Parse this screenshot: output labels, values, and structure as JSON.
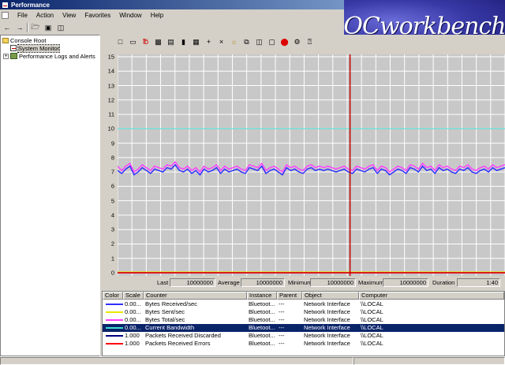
{
  "window": {
    "title": "Performance"
  },
  "menu": [
    "File",
    "Action",
    "View",
    "Favorites",
    "Window",
    "Help"
  ],
  "logo_text": "OCworkbench",
  "tree": {
    "root": "Console Root",
    "items": [
      "System Monitor",
      "Performance Logs and Alerts"
    ]
  },
  "toolbar_icons": [
    "new-counter-set-icon",
    "clear-display-icon",
    "view-current-activity-icon",
    "view-log-data-icon",
    "view-graph-icon",
    "view-histogram-icon",
    "view-report-icon",
    "add-counter-icon",
    "delete-counter-icon",
    "highlight-icon",
    "copy-properties-icon",
    "paste-counter-list-icon",
    "properties-icon",
    "freeze-display-icon",
    "update-data-icon",
    "help-icon"
  ],
  "chart_data": {
    "type": "line",
    "ylim": [
      0,
      15
    ],
    "yticks": [
      0,
      1,
      2,
      3,
      4,
      5,
      6,
      7,
      8,
      9,
      10,
      11,
      12,
      13,
      14,
      15
    ],
    "grid": true,
    "series": [
      {
        "name": "Bytes Received/sec",
        "color": "#3030ff",
        "values": [
          7.1,
          6.9,
          7.2,
          7.4,
          6.8,
          7.0,
          7.3,
          7.1,
          6.9,
          7.2,
          7.1,
          7.0,
          7.3,
          7.2,
          7.5,
          7.1,
          7.0,
          7.2,
          6.9,
          7.1,
          6.8,
          7.2,
          7.0,
          7.1,
          7.3,
          6.9,
          7.2,
          7.0,
          7.1,
          7.2,
          7.0,
          6.9,
          7.3,
          7.2,
          7.1,
          7.4,
          6.9,
          7.1,
          7.2,
          7.0,
          6.8,
          7.3,
          7.1,
          7.2,
          7.0,
          6.9,
          7.2,
          7.3,
          7.1,
          7.2,
          7.1,
          7.2,
          7.1,
          7.0,
          7.1,
          7.2,
          7.0,
          6.9,
          7.2,
          7.1,
          7.0,
          7.2,
          7.3,
          6.9,
          7.2,
          7.1,
          6.8,
          7.0,
          7.2,
          7.1,
          6.9,
          7.3,
          7.2,
          7.0,
          7.4,
          7.1,
          7.2,
          6.9,
          7.3,
          7.1,
          7.2,
          7.0,
          6.9,
          7.2,
          7.1,
          7.3,
          7.0,
          6.9,
          7.1,
          7.2,
          7.0,
          7.3,
          7.1,
          7.2,
          7.3
        ]
      },
      {
        "name": "Bytes Sent/sec",
        "color": "#e8e800",
        "values": [
          0.05,
          0.05,
          0.05,
          0.05,
          0.05,
          0.05,
          0.05,
          0.05,
          0.05,
          0.05
        ]
      },
      {
        "name": "Bytes Total/sec",
        "color": "#ff40ff",
        "values": [
          7.4,
          7.1,
          7.4,
          7.6,
          7.0,
          7.2,
          7.5,
          7.3,
          7.1,
          7.4,
          7.3,
          7.2,
          7.5,
          7.4,
          7.7,
          7.3,
          7.2,
          7.4,
          7.1,
          7.3,
          7.0,
          7.4,
          7.2,
          7.3,
          7.5,
          7.1,
          7.4,
          7.2,
          7.3,
          7.4,
          7.2,
          7.1,
          7.5,
          7.4,
          7.3,
          7.6,
          7.1,
          7.3,
          7.4,
          7.2,
          7.0,
          7.5,
          7.3,
          7.4,
          7.2,
          7.1,
          7.4,
          7.5,
          7.3,
          7.4,
          7.3,
          7.4,
          7.3,
          7.2,
          7.3,
          7.4,
          7.2,
          7.1,
          7.4,
          7.3,
          7.2,
          7.4,
          7.5,
          7.1,
          7.4,
          7.3,
          7.0,
          7.2,
          7.4,
          7.3,
          7.1,
          7.5,
          7.4,
          7.2,
          7.6,
          7.3,
          7.4,
          7.1,
          7.5,
          7.3,
          7.4,
          7.2,
          7.1,
          7.4,
          7.3,
          7.5,
          7.2,
          7.1,
          7.3,
          7.4,
          7.2,
          7.5,
          7.3,
          7.4,
          7.5
        ]
      },
      {
        "name": "Current Bandwidth",
        "color": "#40e0d0",
        "values": [
          10,
          10
        ]
      },
      {
        "name": "Packets Received Discarded",
        "color": "#000080",
        "values": [
          0,
          0
        ]
      },
      {
        "name": "Packets Received Errors",
        "color": "#ff0000",
        "values": [
          0,
          0
        ]
      }
    ],
    "vertical_marker_fraction": 0.6
  },
  "stats": {
    "last_label": "Last",
    "last_value": "10000000",
    "average_label": "Average",
    "average_value": "10000000",
    "minimum_label": "Minimum",
    "minimum_value": "10000000",
    "maximum_label": "Maximum",
    "maximum_value": "10000000",
    "duration_label": "Duration",
    "duration_value": "1:40"
  },
  "legend": {
    "headers": [
      "Color",
      "Scale",
      "Counter",
      "Instance",
      "Parent",
      "Object",
      "Computer"
    ],
    "rows": [
      {
        "color": "#3030ff",
        "scale": "0.00...",
        "counter": "Bytes Received/sec",
        "instance": "Bluetoot...",
        "parent": "---",
        "object": "Network Interface",
        "computer": "\\\\LOCAL"
      },
      {
        "color": "#e8e800",
        "scale": "0.00...",
        "counter": "Bytes Sent/sec",
        "instance": "Bluetoot...",
        "parent": "---",
        "object": "Network Interface",
        "computer": "\\\\LOCAL"
      },
      {
        "color": "#ff40ff",
        "scale": "0.00...",
        "counter": "Bytes Total/sec",
        "instance": "Bluetoot...",
        "parent": "---",
        "object": "Network Interface",
        "computer": "\\\\LOCAL"
      },
      {
        "color": "#40e0d0",
        "scale": "0.00...",
        "counter": "Current Bandwidth",
        "instance": "Bluetoot...",
        "parent": "---",
        "object": "Network Interface",
        "computer": "\\\\LOCAL"
      },
      {
        "color": "#000080",
        "scale": "1.000",
        "counter": "Packets Received Discarded",
        "instance": "Bluetoot...",
        "parent": "---",
        "object": "Network Interface",
        "computer": "\\\\LOCAL"
      },
      {
        "color": "#ff0000",
        "scale": "1.000",
        "counter": "Packets Received Errors",
        "instance": "Bluetoot...",
        "parent": "---",
        "object": "Network Interface",
        "computer": "\\\\LOCAL"
      }
    ]
  }
}
